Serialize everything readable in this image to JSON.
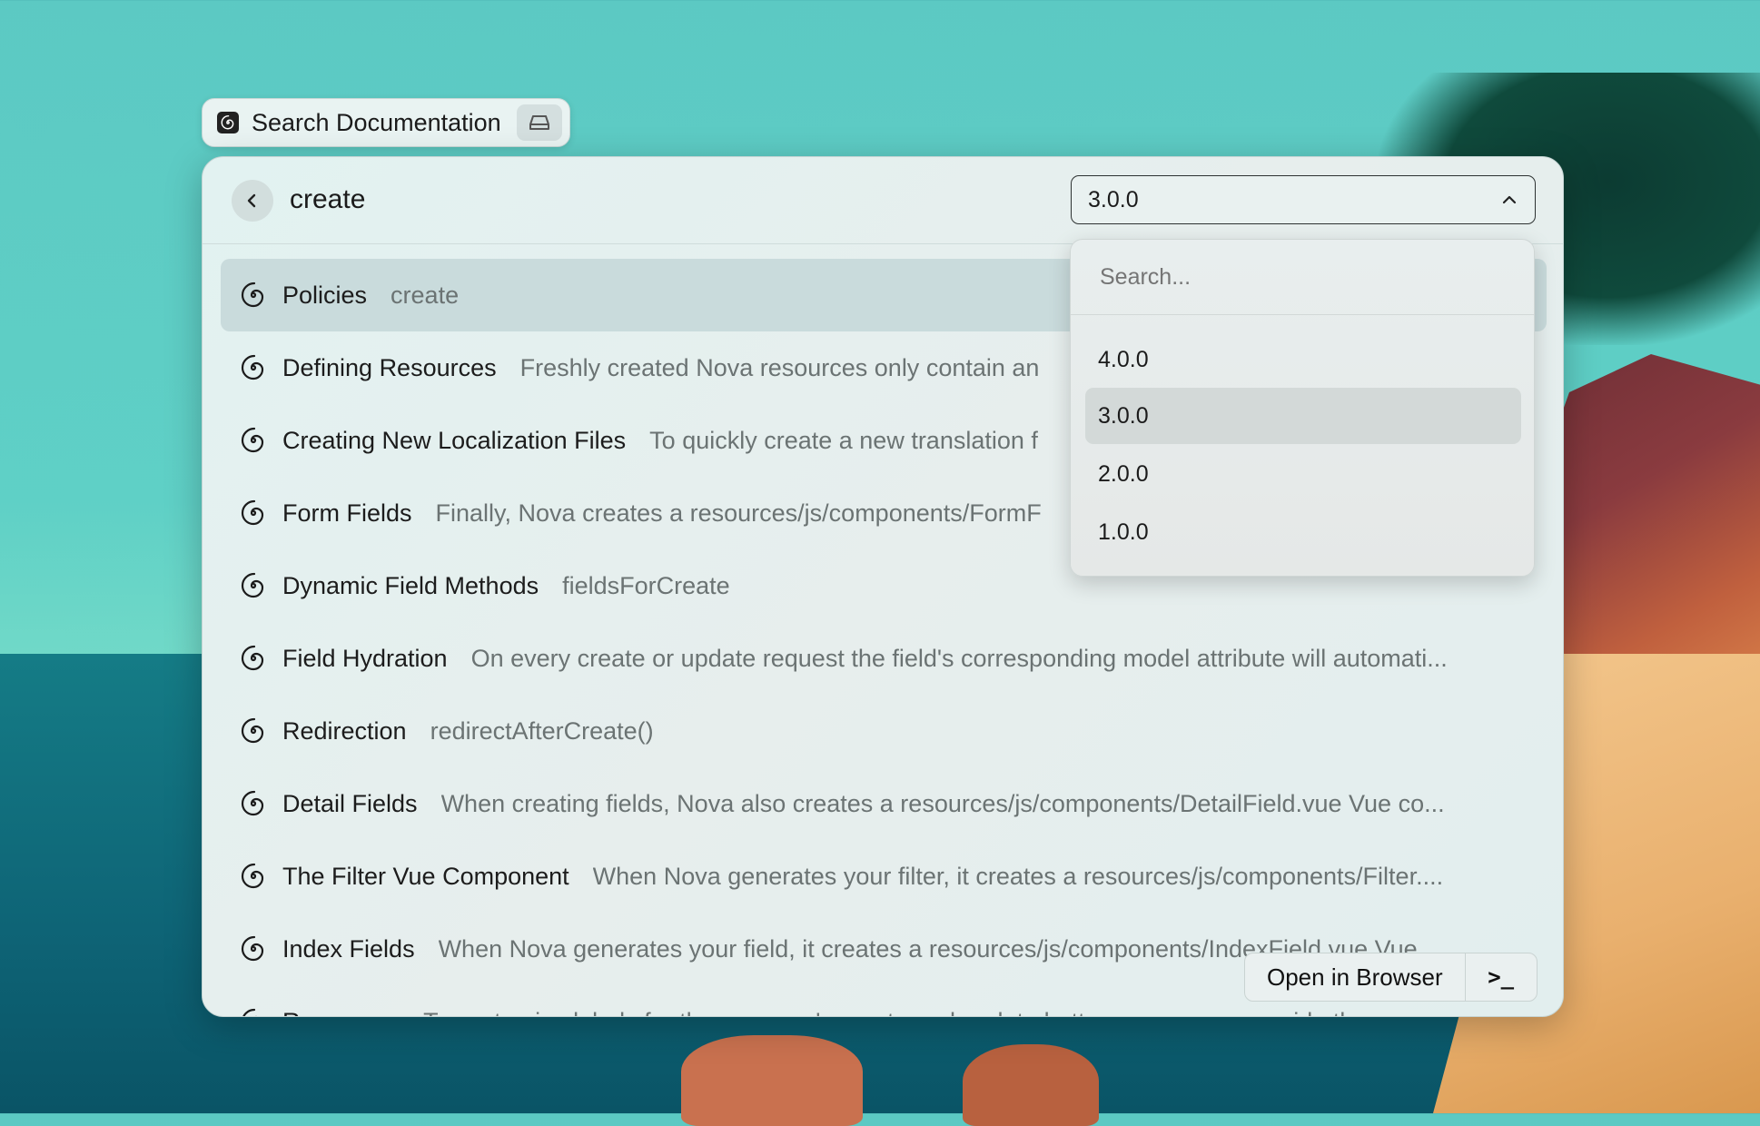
{
  "pill": {
    "title": "Search Documentation",
    "logo_icon": "nova-spiral-icon",
    "action_icon": "drive-icon"
  },
  "header": {
    "back_icon": "chevron-left-icon",
    "query": "create",
    "version": {
      "selected": "3.0.0",
      "chevron_icon": "chevron-up-icon"
    }
  },
  "dropdown": {
    "search_placeholder": "Search...",
    "options": [
      "4.0.0",
      "3.0.0",
      "2.0.0",
      "1.0.0"
    ],
    "selected": "3.0.0"
  },
  "results": [
    {
      "title": "Policies",
      "subtitle": "create",
      "active": true
    },
    {
      "title": "Defining Resources",
      "subtitle": "Freshly created Nova resources only contain an"
    },
    {
      "title": "Creating New Localization Files",
      "subtitle": "To quickly create a new translation f"
    },
    {
      "title": "Form Fields",
      "subtitle": "Finally, Nova creates a  resources/js/components/FormF"
    },
    {
      "title": "Dynamic Field Methods",
      "subtitle": "fieldsForCreate"
    },
    {
      "title": "Field Hydration",
      "subtitle": "On every create or update request the field's corresponding model attribute will automati..."
    },
    {
      "title": "Redirection",
      "subtitle": "redirectAfterCreate()"
    },
    {
      "title": "Detail Fields",
      "subtitle": "When creating fields, Nova also creates a  resources/js/components/DetailField.vue  Vue co..."
    },
    {
      "title": "The Filter Vue Component",
      "subtitle": "When Nova generates your filter, it creates a  resources/js/components/Filter...."
    },
    {
      "title": "Index Fields",
      "subtitle": "When Nova generates your field, it creates a  resources/js/components/IndexField.vue  Vue"
    },
    {
      "title": "Resources",
      "subtitle": "To customize labels for the resource's create and update buttons, you may override the"
    }
  ],
  "footer": {
    "open_label": "Open in Browser",
    "terminal_label": ">_"
  },
  "colors": {
    "window_bg": "#e4efee",
    "active_row": "#c9dbdc",
    "text_primary": "#1c1c1c",
    "text_secondary": "#6b7373"
  }
}
